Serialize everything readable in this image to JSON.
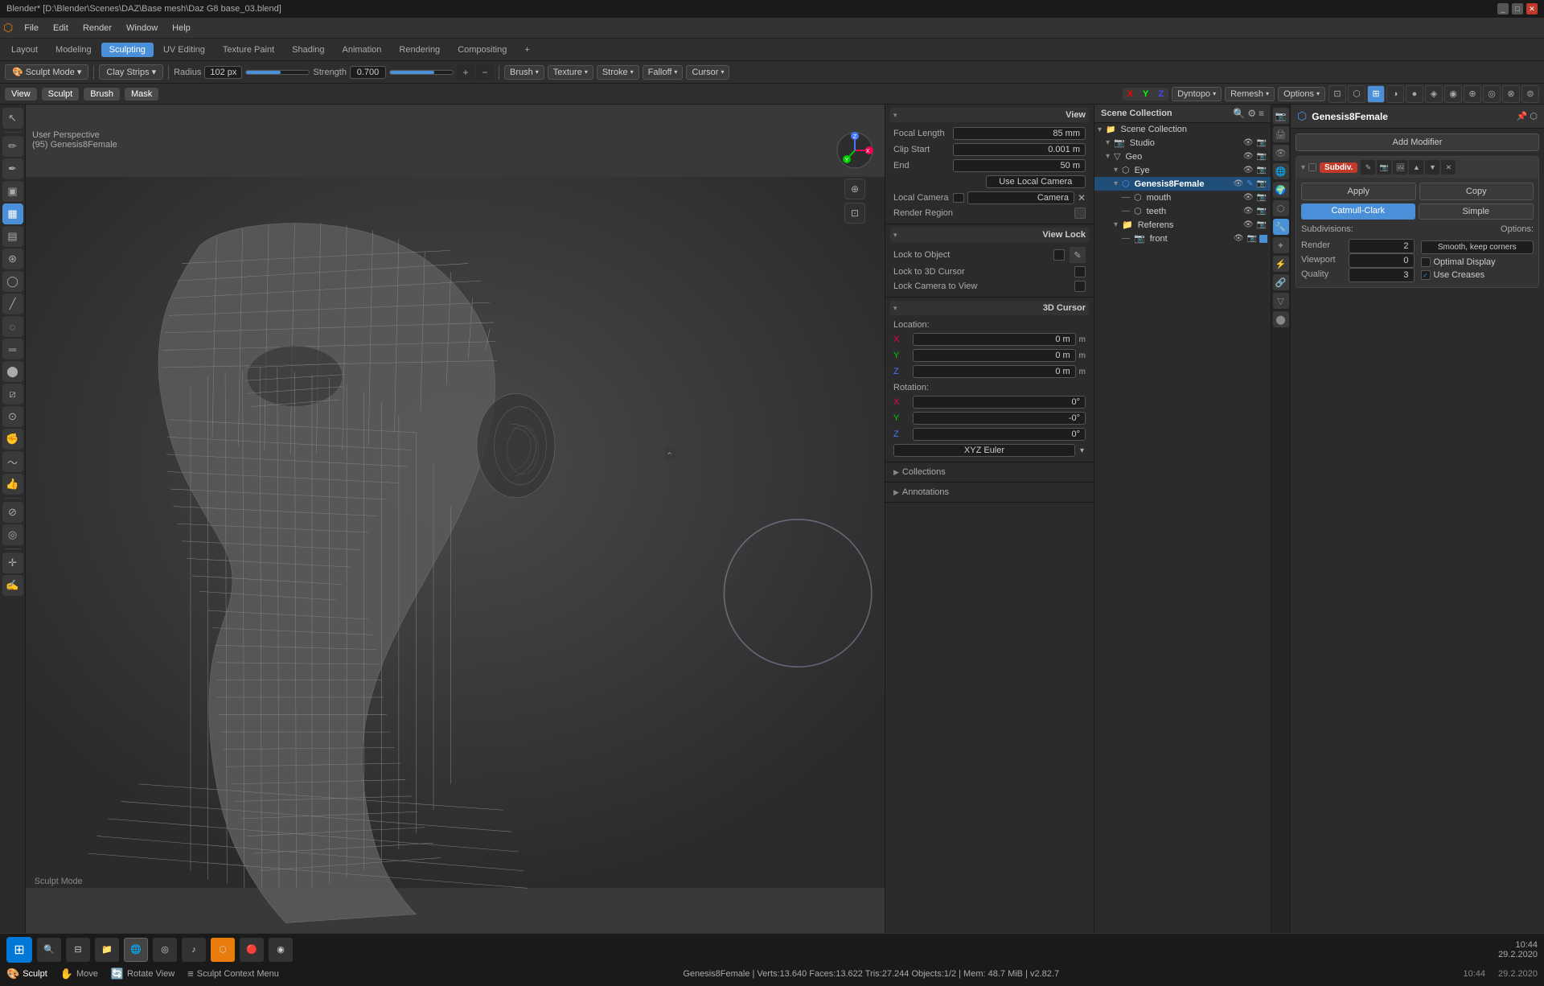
{
  "window": {
    "title": "Blender* [D:\\Blender\\Scenes\\DAZ\\Base mesh\\Daz G8 base_03.blend]"
  },
  "menu": {
    "items": [
      "File",
      "Edit",
      "Render",
      "Window",
      "Help"
    ],
    "workspaces": [
      "Layout",
      "Modeling",
      "Sculpting",
      "UV Editing",
      "Texture Paint",
      "Shading",
      "Animation",
      "Rendering",
      "Compositing",
      "+"
    ]
  },
  "toolbar": {
    "mode_label": "Sculpt Mode",
    "brush_name": "Clay Strips",
    "radius_label": "Radius",
    "radius_value": "102 px",
    "strength_label": "Strength",
    "strength_value": "0.700",
    "brush_label": "Brush",
    "texture_label": "Texture",
    "stroke_label": "Stroke",
    "falloff_label": "Falloff",
    "cursor_label": "Cursor",
    "sculpt_tab": "Sculpt",
    "brush_tab": "Brush",
    "mask_tab": "Mask"
  },
  "viewport": {
    "perspective_label": "User Perspective",
    "object_label": "(95) Genesis8Female",
    "x_label": "X",
    "y_label": "Y",
    "z_label": "Z",
    "dyntopo": "Dyntopo",
    "remesh": "Remesh",
    "options": "Options"
  },
  "n_panel": {
    "view_section": "View",
    "focal_length_label": "Focal Length",
    "focal_length_value": "85 mm",
    "clip_start_label": "Clip Start",
    "clip_start_value": "0.001 m",
    "end_label": "End",
    "end_value": "50 m",
    "use_local_camera": "Use Local Camera",
    "local_camera_label": "Local Camera",
    "camera_label": "Camera",
    "render_region": "Render Region",
    "view_lock_section": "View Lock",
    "lock_to_object": "Lock to Object",
    "lock_to_3d_cursor": "Lock to 3D Cursor",
    "lock_camera_to_view": "Lock Camera to View",
    "cursor_3d_section": "3D Cursor",
    "location_label": "Location:",
    "x_loc": "0 m",
    "y_loc": "0 m",
    "z_loc": "0 m",
    "rotation_label": "Rotation:",
    "x_rot": "0°",
    "y_rot": "-0°",
    "z_rot": "0°",
    "xyz_euler": "XYZ Euler",
    "collections_section": "Collections",
    "annotations_section": "Annotations"
  },
  "scene_collection": {
    "title": "Scene Collection",
    "items": [
      {
        "name": "Studio",
        "level": 1,
        "icon": "📷",
        "visible": true
      },
      {
        "name": "Geo",
        "level": 1,
        "icon": "▽",
        "visible": true
      },
      {
        "name": "Eye",
        "level": 2,
        "icon": "👁",
        "visible": true
      },
      {
        "name": "Genesis8Female",
        "level": 2,
        "icon": "⬡",
        "visible": true,
        "selected": true
      },
      {
        "name": "mouth",
        "level": 3,
        "icon": "⬡",
        "visible": true
      },
      {
        "name": "teeth",
        "level": 3,
        "icon": "⬡",
        "visible": true
      },
      {
        "name": "Referens",
        "level": 2,
        "icon": "📷",
        "visible": true
      },
      {
        "name": "front",
        "level": 3,
        "icon": "📷",
        "visible": true
      }
    ]
  },
  "properties": {
    "object_name": "Genesis8Female",
    "add_modifier_label": "Add Modifier",
    "modifier": {
      "badge": "Subdiv.",
      "apply_label": "Apply",
      "copy_label": "Copy",
      "catmull_label": "Catmull-Clark",
      "simple_label": "Simple",
      "subdivisions_label": "Subdivisions:",
      "render_label": "Render",
      "render_value": "2",
      "viewport_label": "Viewport",
      "viewport_value": "0",
      "quality_label": "Quality",
      "quality_value": "3",
      "options_label": "Options:",
      "smooth_corners_label": "Smooth, keep corners",
      "optimal_display_label": "Optimal Display",
      "use_creases_label": "Use Creases"
    }
  },
  "status_bar": {
    "sculpt_label": "Sculpt",
    "move_label": "Move",
    "rotate_label": "Rotate View",
    "context_menu_label": "Sculpt Context Menu",
    "obj_info": "Genesis8Female | Verts:13.640  Faces:13.622  Tris:27.244  Objects:1/2  |  Mem: 48.7 MiB  |  v2.82.7",
    "time": "10:44",
    "date": "29.2.2020"
  },
  "icons": {
    "search": "🔍",
    "gear": "⚙",
    "camera": "📷",
    "eye": "👁",
    "arrow_down": "▾",
    "arrow_right": "▶",
    "close": "✕",
    "check": "✓",
    "move": "✋",
    "rotate": "🔄",
    "scale": "⊡",
    "draw": "✏",
    "smooth": "◌",
    "grab": "✊",
    "snake": "〜",
    "thumb": "👍",
    "fill": "⬤",
    "scrape": "⧄",
    "multi": "⊕",
    "pinch": "⊙",
    "inflate": "⊛",
    "blob": "◯",
    "crease": "╱",
    "flatten": "═",
    "clay": "▣",
    "clay_strips": "▦",
    "layer": "▤",
    "mask": "⊘",
    "grab_active": "◎"
  }
}
